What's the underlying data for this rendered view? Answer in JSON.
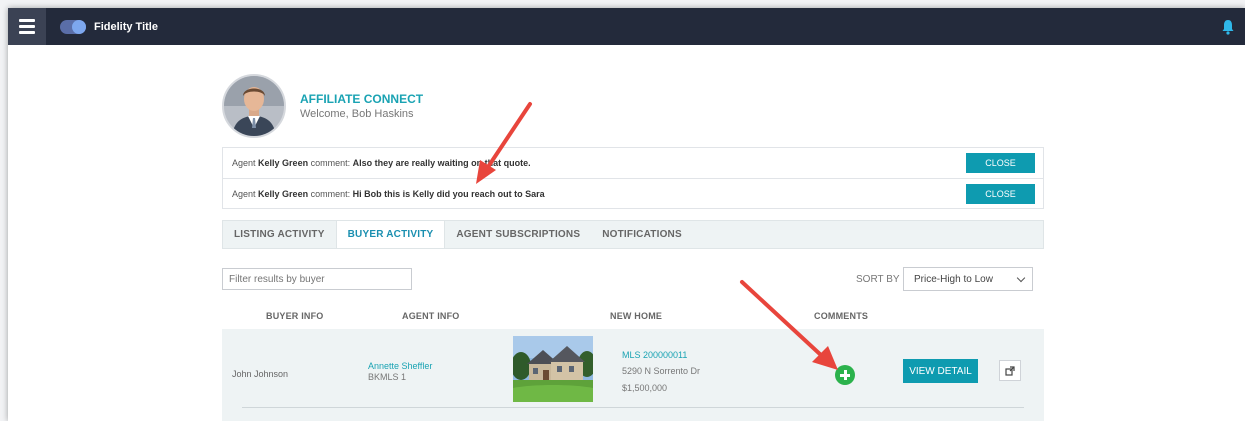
{
  "topbar": {
    "brand": "Fidelity Title"
  },
  "header": {
    "title": "AFFILIATE CONNECT",
    "welcome": "Welcome, Bob Haskins"
  },
  "alerts": [
    {
      "prefix": "Agent",
      "agent": "Kelly Green",
      "mid": "comment:",
      "message": "Also they are really waiting on that quote.",
      "close_label": "CLOSE"
    },
    {
      "prefix": "Agent",
      "agent": "Kelly Green",
      "mid": "comment:",
      "message": "Hi Bob this is Kelly did you reach out to Sara",
      "close_label": "CLOSE"
    }
  ],
  "tabs": [
    {
      "label": "LISTING ACTIVITY",
      "active": false
    },
    {
      "label": "BUYER ACTIVITY",
      "active": true
    },
    {
      "label": "AGENT SUBSCRIPTIONS",
      "active": false
    },
    {
      "label": "NOTIFICATIONS",
      "active": false
    }
  ],
  "filter": {
    "placeholder": "Filter results by buyer"
  },
  "sort": {
    "label": "SORT BY",
    "selected": "Price-High to Low"
  },
  "columns": {
    "buyer": "BUYER INFO",
    "agent": "AGENT INFO",
    "home": "NEW HOME",
    "comments": "COMMENTS"
  },
  "rows": [
    {
      "buyer": "John Johnson",
      "agent_name": "Annette Sheffler",
      "agent_id": "BKMLS 1",
      "mls": "MLS 200000011",
      "address": "5290 N Sorrento Dr",
      "price": "$1,500,000",
      "view_label": "VIEW DETAIL"
    }
  ],
  "colors": {
    "accent": "#1aa3b3",
    "button": "#0e9bb0",
    "topbar": "#232a3b",
    "add": "#2bb24c",
    "annotation": "#e8453c"
  },
  "icons": [
    "menu-icon",
    "toggle-icon",
    "bell-icon",
    "add-comment-icon",
    "external-link-icon"
  ]
}
